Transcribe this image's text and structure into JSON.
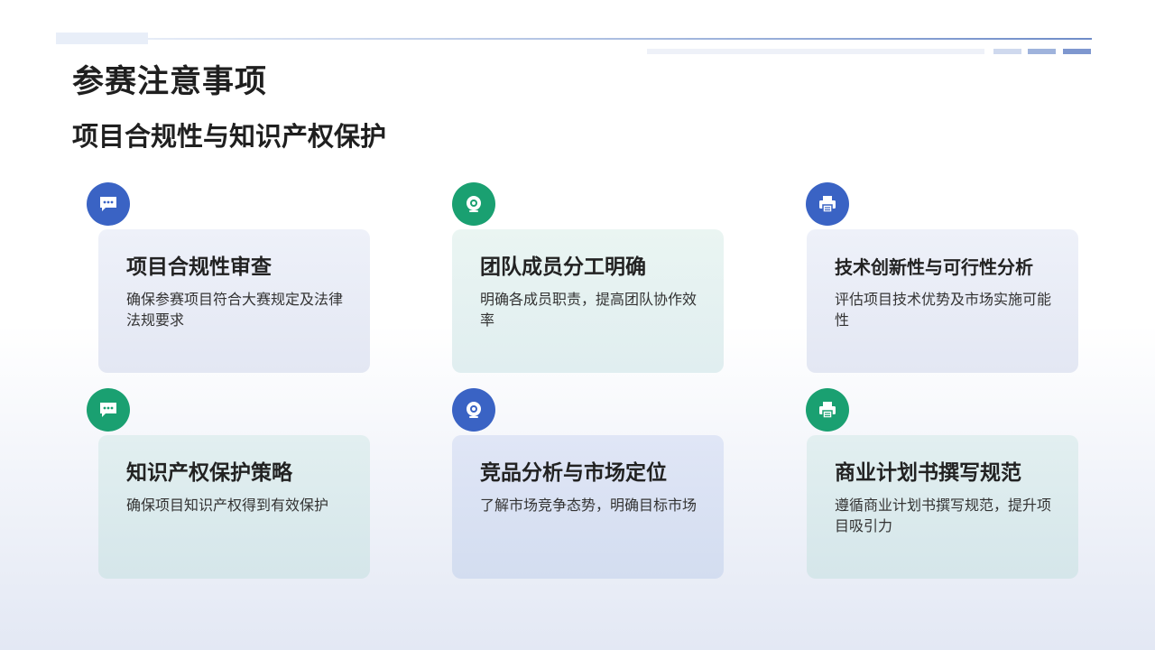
{
  "header": {
    "title": "参赛注意事项",
    "subtitle": "项目合规性与知识产权保护"
  },
  "cards": [
    {
      "title": "项目合规性审查",
      "desc": "确保参赛项目符合大赛规定及法律法规要求",
      "icon": "chat-bubble-icon",
      "icon_color": "#3a63c4"
    },
    {
      "title": "团队成员分工明确",
      "desc": "明确各成员职责，提高团队协作效率",
      "icon": "webcam-icon",
      "icon_color": "#1aa071"
    },
    {
      "title": "技术创新性与可行性分析",
      "desc": "评估项目技术优势及市场实施可能性",
      "icon": "printer-icon",
      "icon_color": "#3a63c4"
    },
    {
      "title": "知识产权保护策略",
      "desc": "确保项目知识产权得到有效保护",
      "icon": "chat-bubble-icon",
      "icon_color": "#1aa071"
    },
    {
      "title": "竞品分析与市场定位",
      "desc": "了解市场竞争态势，明确目标市场",
      "icon": "webcam-icon",
      "icon_color": "#3a63c4"
    },
    {
      "title": "商业计划书撰写规范",
      "desc": "遵循商业计划书撰写规范，提升项目吸引力",
      "icon": "printer-icon",
      "icon_color": "#1aa071"
    }
  ]
}
